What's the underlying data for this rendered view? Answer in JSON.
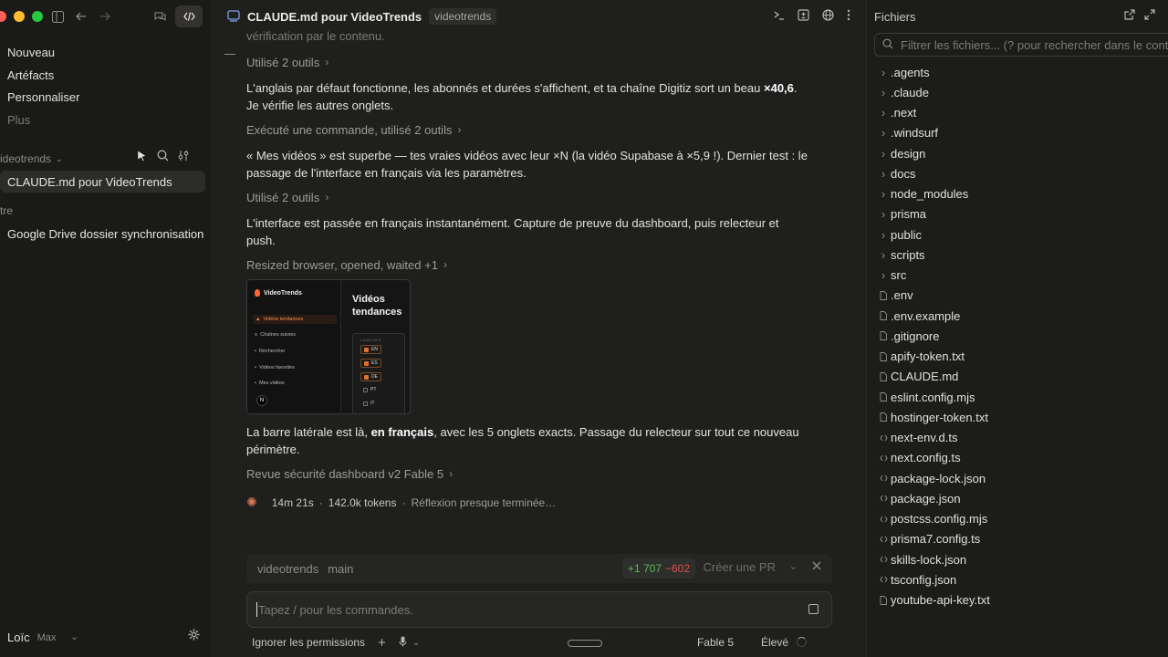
{
  "sidebar": {
    "nav": [
      "Nouveau",
      "Artéfacts",
      "Personnaliser",
      "Plus"
    ],
    "project_section": "ideotrends",
    "sessions": [
      "CLAUDE.md pour VideoTrends"
    ],
    "other_section": "tre",
    "other_sessions": [
      "Google Drive dossier synchronisation"
    ],
    "user_name": "Loïc",
    "user_plan": "Max"
  },
  "header": {
    "title": "CLAUDE.md pour VideoTrends",
    "repo_chip": "videotrends"
  },
  "chat": {
    "ghost_text": "vérification par le contenu.",
    "tool1": "Utilisé 2 outils",
    "msg1_a": "L'anglais par défaut fonctionne, les abonnés et durées s'affichent, et ta chaîne Digitiz sort un beau ",
    "msg1_b": "×40,6",
    "msg1_c": ".",
    "msg1_line2": "Je vérifie les autres onglets.",
    "tool2": "Exécuté une commande, utilisé 2 outils",
    "msg2_line1": "« Mes vidéos » est superbe — tes vraies vidéos avec leur ×N (la vidéo Supabase à ×5,9 !). Dernier test : le",
    "msg2_line2": "passage de l'interface en français via les paramètres.",
    "tool3": "Utilisé 2 outils",
    "msg3_line1": "L'interface est passée en français instantanément. Capture de preuve du dashboard, puis relecteur et",
    "msg3_line2": "push.",
    "tool4": "Resized browser, opened, waited +1",
    "msg4_a": "La barre latérale est là, ",
    "msg4_b": "en français",
    "msg4_c": ", avec les 5 onglets exacts. Passage du relecteur sur tout ce nouveau",
    "msg4_line2": "périmètre.",
    "tool5": "Revue sécurité dashboard v2 Fable 5",
    "status_time": "14m 21s",
    "status_tokens": "142.0k tokens",
    "status_text": "Réflexion presque terminée…"
  },
  "thumbnail": {
    "brand": "VideoTrends",
    "nav": [
      "Vidéos tendances",
      "Chaînes suivies",
      "Rechercher",
      "Vidéos favorites",
      "Mes vidéos"
    ],
    "heading": "Vidéos tendances",
    "panel_header": "LANGUES",
    "langs": [
      {
        "code": "EN",
        "checked": true
      },
      {
        "code": "ES",
        "checked": true
      },
      {
        "code": "DE",
        "checked": true
      },
      {
        "code": "PT",
        "checked": false
      },
      {
        "code": "IT",
        "checked": false
      }
    ],
    "avatar": "N"
  },
  "composer": {
    "repo": "videotrends",
    "branch": "main",
    "additions": "+1 707",
    "deletions": "−602",
    "pr_label": "Créer une PR",
    "placeholder": "Tapez / pour les commandes.",
    "permissions": "Ignorer les permissions",
    "model": "Fable 5",
    "effort": "Élevé"
  },
  "files": {
    "title": "Fichiers",
    "search_placeholder": "Filtrer les fichiers... (? pour rechercher dans le contenu)",
    "items": [
      {
        "name": ".agents",
        "kind": "folder"
      },
      {
        "name": ".claude",
        "kind": "folder"
      },
      {
        "name": ".next",
        "kind": "folder"
      },
      {
        "name": ".windsurf",
        "kind": "folder"
      },
      {
        "name": "design",
        "kind": "folder"
      },
      {
        "name": "docs",
        "kind": "folder"
      },
      {
        "name": "node_modules",
        "kind": "folder"
      },
      {
        "name": "prisma",
        "kind": "folder"
      },
      {
        "name": "public",
        "kind": "folder"
      },
      {
        "name": "scripts",
        "kind": "folder"
      },
      {
        "name": "src",
        "kind": "folder"
      },
      {
        "name": ".env",
        "kind": "file"
      },
      {
        "name": ".env.example",
        "kind": "file"
      },
      {
        "name": ".gitignore",
        "kind": "file"
      },
      {
        "name": "apify-token.txt",
        "kind": "file"
      },
      {
        "name": "CLAUDE.md",
        "kind": "file"
      },
      {
        "name": "eslint.config.mjs",
        "kind": "file"
      },
      {
        "name": "hostinger-token.txt",
        "kind": "file"
      },
      {
        "name": "next-env.d.ts",
        "kind": "code"
      },
      {
        "name": "next.config.ts",
        "kind": "code"
      },
      {
        "name": "package-lock.json",
        "kind": "code"
      },
      {
        "name": "package.json",
        "kind": "code"
      },
      {
        "name": "postcss.config.mjs",
        "kind": "code"
      },
      {
        "name": "prisma7.config.ts",
        "kind": "code"
      },
      {
        "name": "skills-lock.json",
        "kind": "code"
      },
      {
        "name": "tsconfig.json",
        "kind": "code"
      },
      {
        "name": "youtube-api-key.txt",
        "kind": "file"
      }
    ]
  }
}
